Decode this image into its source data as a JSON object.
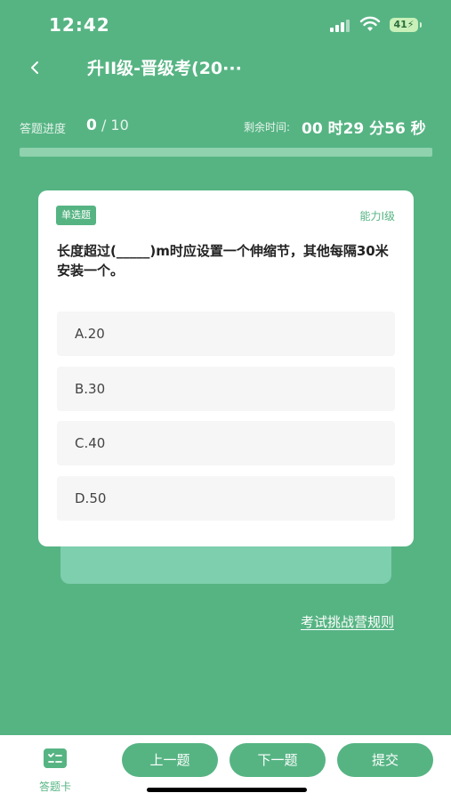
{
  "status_bar": {
    "time": "12:42",
    "battery": "41",
    "icons": [
      "signal-icon",
      "wifi-icon",
      "battery-charging-icon"
    ]
  },
  "nav": {
    "back_icon": "chevron-left-icon",
    "title": "升II级-晋级考(20···"
  },
  "progress": {
    "label": "答题进度",
    "current": "0",
    "total": "/ 10",
    "fraction": 0.0
  },
  "timer": {
    "label": "剩余时间:",
    "value": "00 时29 分56 秒"
  },
  "question": {
    "type": "单选题",
    "level": "能力I级",
    "text": "长度超过(_____)m时应设置一个伸缩节，其他每隔30米安装一个。",
    "options": [
      {
        "label": "A.20"
      },
      {
        "label": "B.30"
      },
      {
        "label": "C.40"
      },
      {
        "label": "D.50"
      }
    ]
  },
  "rules_link": "考试挑战营规则",
  "bottom_bar": {
    "answer_card": {
      "icon": "answer-card-icon",
      "label": "答题卡"
    },
    "prev": "上一题",
    "next": "下一题",
    "submit": "提交"
  },
  "colors": {
    "accent": "#56b483",
    "card": "#ffffff",
    "option_bg": "#f6f6f6",
    "track": "#8fd2ad",
    "shadow_card": "#7ecfae"
  }
}
